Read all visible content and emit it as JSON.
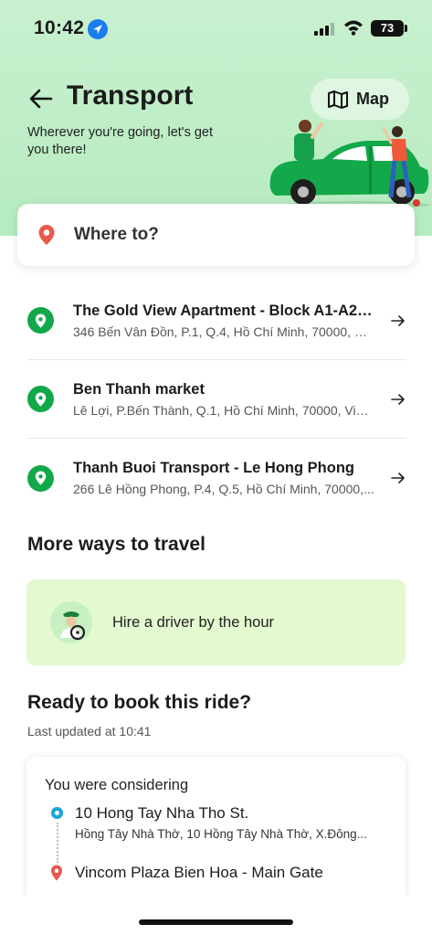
{
  "status_bar": {
    "time": "10:42",
    "battery": "73",
    "icons": [
      "location-arrow-icon",
      "signal-icon",
      "wifi-icon",
      "battery-icon"
    ]
  },
  "header": {
    "title": "Transport",
    "subtitle": "Wherever you're going, let's get you there!",
    "map_label": "Map",
    "icons": [
      "back-arrow-icon",
      "map-icon"
    ]
  },
  "search": {
    "placeholder": "Where to?",
    "icon": "location-pin-icon"
  },
  "saved_locations": [
    {
      "name": "The Gold View Apartment - Block A1-A2-...",
      "address": "346 Bến Vân Đồn, P.1, Q.4, Hồ Chí Minh, 70000, Vi..."
    },
    {
      "name": "Ben Thanh market",
      "address": "Lê Lợi, P.Bến Thành, Q.1, Hồ Chí Minh, 70000, Viet..."
    },
    {
      "name": "Thanh Buoi Transport - Le Hong Phong",
      "address": "266 Lê Hồng Phong, P.4, Q.5, Hồ Chí Minh, 70000,..."
    }
  ],
  "more_ways": {
    "title": "More ways to travel",
    "hire_label": "Hire a driver by the hour"
  },
  "ready": {
    "title": "Ready to book this ride?",
    "updated": "Last updated at 10:41",
    "card_title": "You were considering",
    "from_name": "10 Hong Tay Nha Tho St.",
    "from_address": "Hồng Tây Nhà Thờ, 10 Hồng Tây Nhà Thờ, X.Đông...",
    "to_name": "Vincom Plaza Bien Hoa - Main Gate"
  },
  "colors": {
    "hero_green": "#c9f0cf",
    "brand_green": "#12a84a",
    "hire_card_bg": "#e3f9cf",
    "pickup_blue": "#1ba7d6",
    "dropoff_red": "#e8594a"
  }
}
